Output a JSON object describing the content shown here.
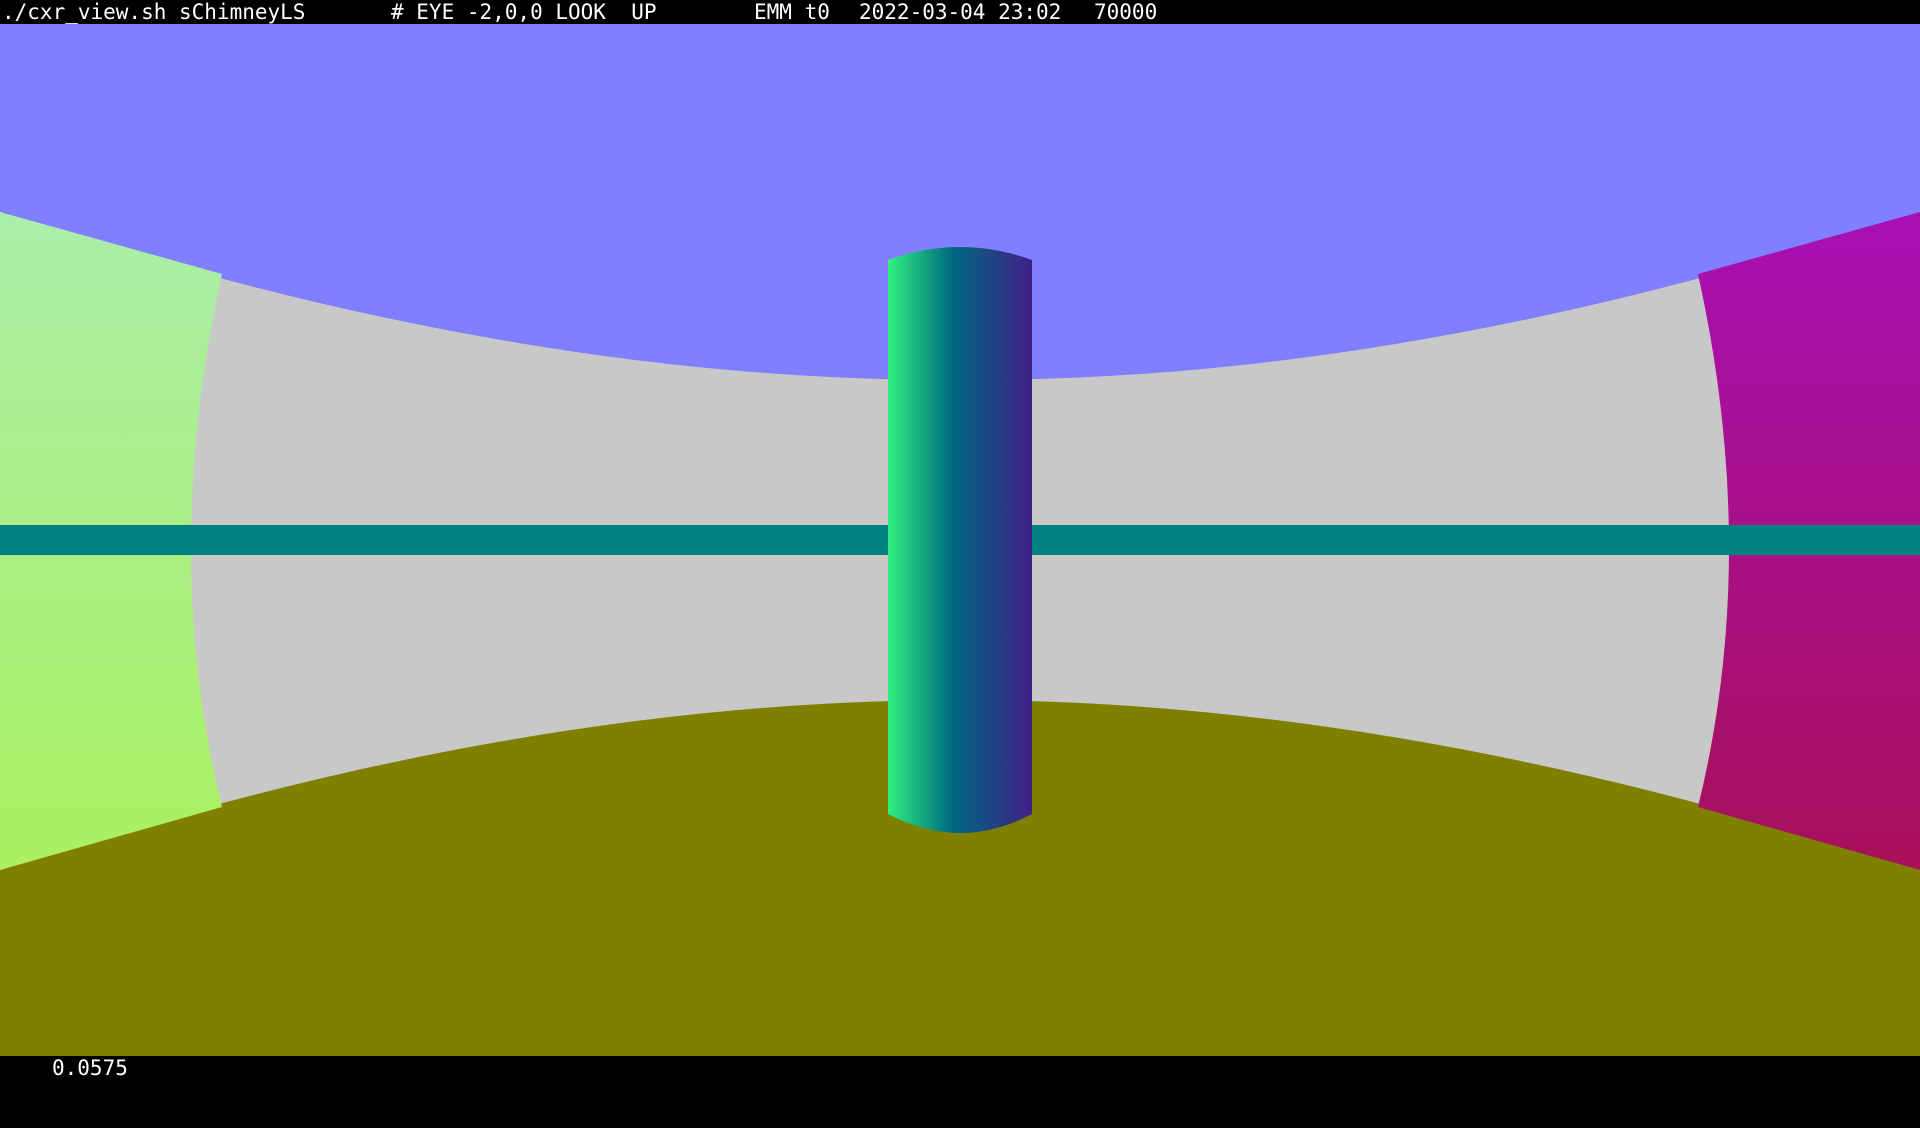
{
  "header": {
    "command": "./cxr_view.sh sChimneyLS",
    "eye_look": "# EYE -2,0,0 LOOK  UP",
    "mode": "EMM t0",
    "datetime": "2022-03-04 23:02",
    "count": "70000"
  },
  "footer": {
    "value": "0.0575"
  },
  "scene": {
    "colors": {
      "sky": "#8080ff",
      "floor": "#808000",
      "wall": "#c8c8c8",
      "band": "#008080",
      "left_panel_top": "#aaeeaa",
      "left_panel_bottom": "#aaf060",
      "right_panel_top": "#a810b4",
      "right_panel_bottom": "#a8105a",
      "cylinder_left": "#30f080",
      "cylinder_mid": "#006880",
      "cylinder_right": "#402088"
    }
  }
}
